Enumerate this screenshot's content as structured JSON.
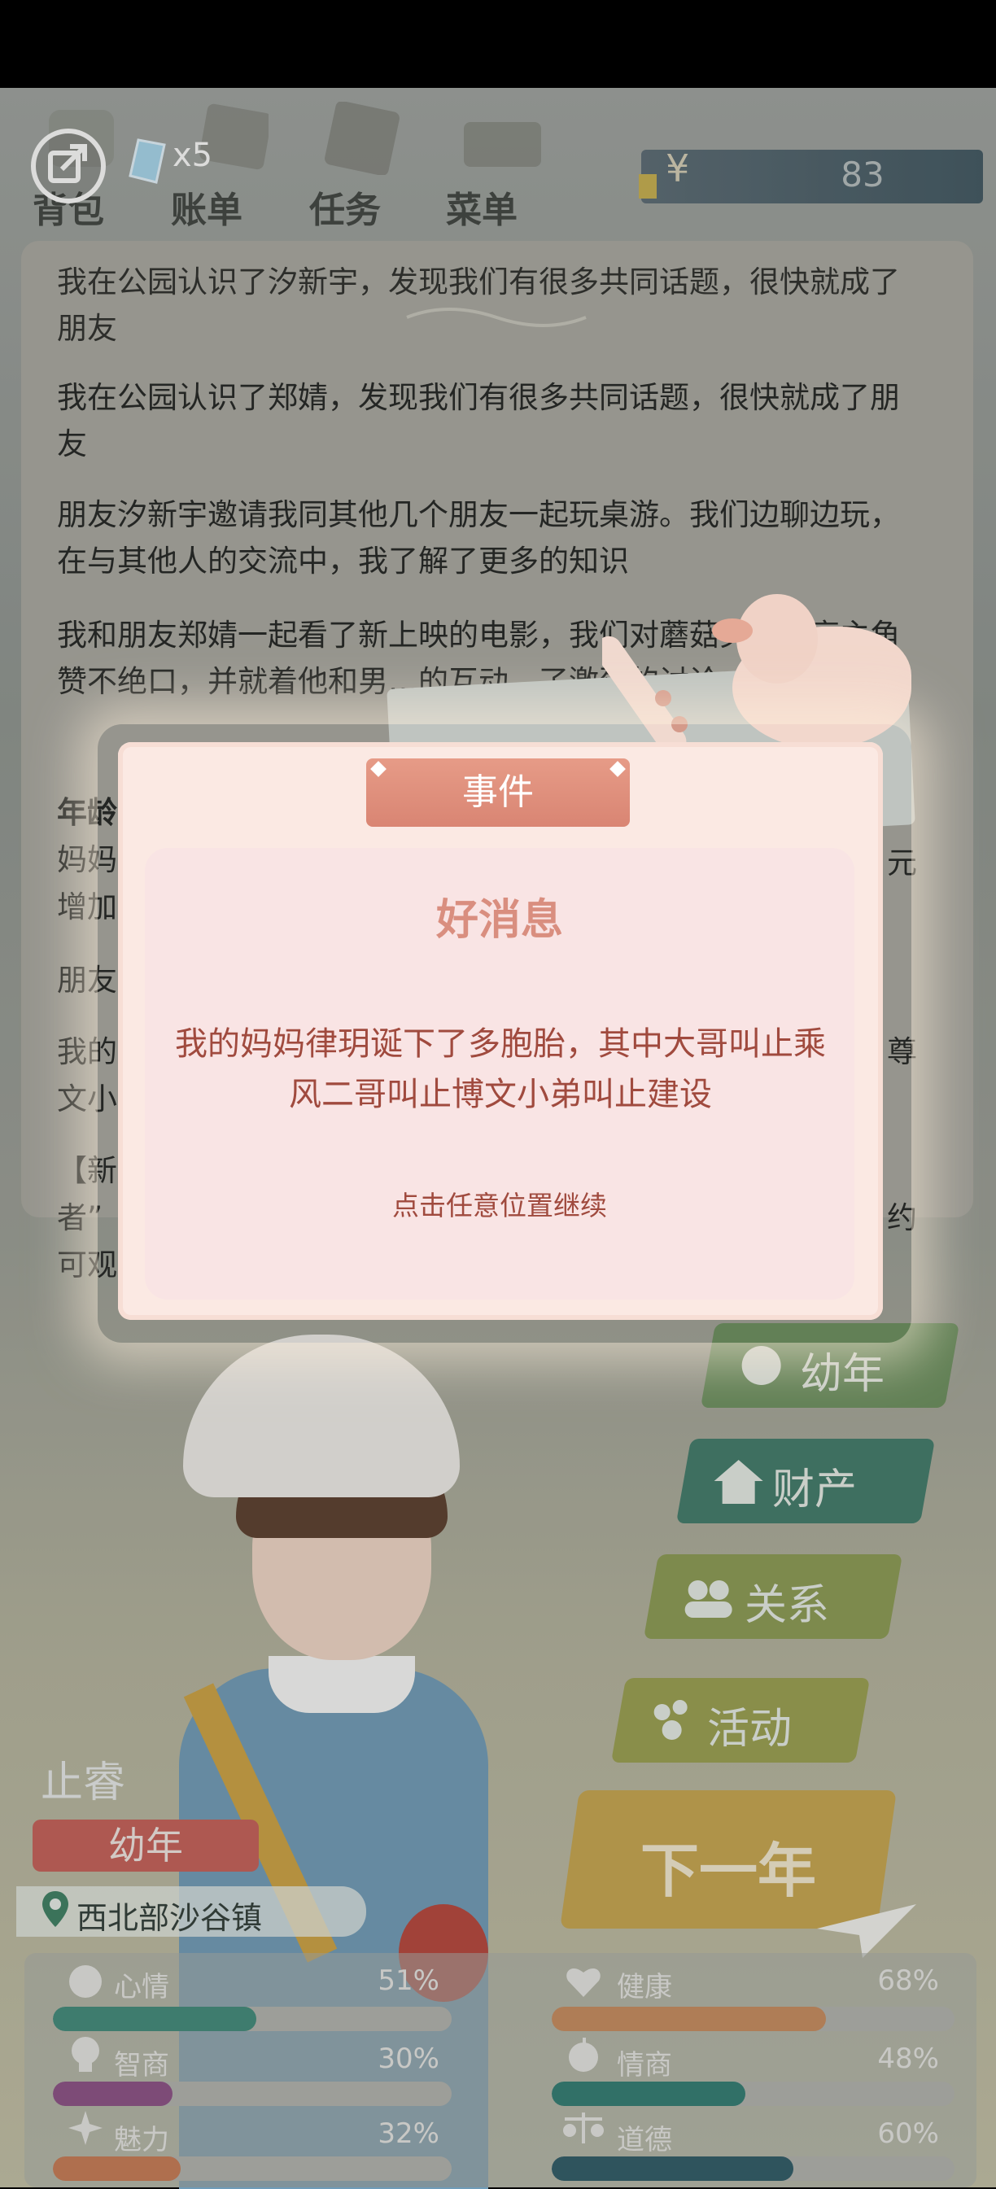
{
  "topbar": {
    "tabs": [
      {
        "label": "背包",
        "icon": "backpack-icon"
      },
      {
        "label": "账单",
        "icon": "bill-icon"
      },
      {
        "label": "任务",
        "icon": "task-icon"
      },
      {
        "label": "菜单",
        "icon": "menu-book-icon"
      }
    ],
    "gem_count": "x5",
    "money_symbol": "¥",
    "money_value": "83"
  },
  "log": {
    "lines": [
      "我在公园认识了汐新宇，发现我们有很多共同话题，很快就成了朋友",
      "我在公园认识了郑婧，发现我们有很多共同话题，很快就成了朋友",
      "朋友汐新宇邀请我同其他几个朋友一起玩桌游。我们边聊边玩，在与其他人的交流中，我了解了更多的知识",
      "我和朋友郑婧一起看了新上映的电影，我们对蘑菇头的漂亮主角赞不绝口，并就着他和男…的互动…了激烈的讨论"
    ],
    "partial": [
      "年龄",
      "妈妈",
      "增加",
      "朋友",
      "我的",
      "文小",
      "【新",
      "者”",
      "可观",
      "元",
      "尊",
      "约"
    ]
  },
  "modal": {
    "header": "事件",
    "title": "好消息",
    "message": "我的妈妈律玥诞下了多胞胎，其中大哥叫止乘风二哥叫止博文小弟叫止建设",
    "hint": "点击任意位置继续"
  },
  "side_buttons": [
    {
      "label": "幼年",
      "icon": "baby-icon",
      "color": "#6b8f5d"
    },
    {
      "label": "财产",
      "icon": "house-icon",
      "color": "#3f7a6a"
    },
    {
      "label": "关系",
      "icon": "people-icon",
      "color": "#8b9b52"
    },
    {
      "label": "活动",
      "icon": "activity-icon",
      "color": "#9aa04f"
    }
  ],
  "character": {
    "name": "止睿",
    "stage": "幼年",
    "location": "西北部沙谷镇"
  },
  "next_year": "下一年",
  "stats": [
    {
      "label": "心情",
      "value": "51%",
      "fraction": 0.51,
      "icon": "smile-icon",
      "color": "#3f8a7a"
    },
    {
      "label": "健康",
      "value": "68%",
      "fraction": 0.68,
      "icon": "heart-icon",
      "color": "#c88c5d"
    },
    {
      "label": "智商",
      "value": "30%",
      "fraction": 0.3,
      "icon": "bulb-icon",
      "color": "#8c4f86"
    },
    {
      "label": "情商",
      "value": "48%",
      "fraction": 0.48,
      "icon": "apple-icon",
      "color": "#2f7c72"
    },
    {
      "label": "魅力",
      "value": "32%",
      "fraction": 0.32,
      "icon": "sparkle-icon",
      "color": "#c97a54"
    },
    {
      "label": "道德",
      "value": "60%",
      "fraction": 0.6,
      "icon": "scale-icon",
      "color": "#2d5a66"
    }
  ]
}
